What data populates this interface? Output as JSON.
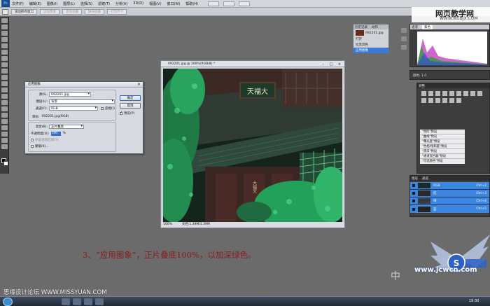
{
  "menubar": {
    "logo": "Ps",
    "items": [
      "文件(F)",
      "编辑(E)",
      "图像(I)",
      "图层(L)",
      "选择(S)",
      "滤镜(T)",
      "分析(A)",
      "3D(D)",
      "视图(V)",
      "窗口(W)",
      "帮助(H)"
    ]
  },
  "options_bar": {
    "buttons": [
      "滚动所有窗口",
      "实际像素",
      "适合屏幕",
      "填充屏幕",
      "打印尺寸"
    ]
  },
  "watermark_top": {
    "line1": "网页教学网",
    "line2": "WWW.WEBJX.COM"
  },
  "document": {
    "title": "092201.jpg @ 100%(RGB/8) *",
    "zoom": "100%",
    "doc_info": "文档:1.39M/1.39M",
    "sign_top": "天福大",
    "sign_side": "大福天"
  },
  "dialog": {
    "title": "应用图象",
    "source_label": "源(S):",
    "source_value": "092201.jpg",
    "layer_label": "图层(L):",
    "layer_value": "背景",
    "channel_label": "通道(C):",
    "channel_value": "RGB",
    "invert_label": "反相(I)",
    "target_label": "目标:",
    "target_value": "092201.jpg(RGB)",
    "blend_label": "混合(B):",
    "blend_value": "正片叠底",
    "opacity_label": "不透明度(O):",
    "opacity_value": "100",
    "opacity_unit": "%",
    "preserve_label": "保留透明区域(T)",
    "mask_label": "蒙版(K)...",
    "ok_label": "确定",
    "cancel_label": "取消",
    "preview_label": "预览(P)"
  },
  "history_panel": {
    "tabs": [
      "历史记录",
      "动作"
    ],
    "snapshot": "092201.jpg",
    "items": [
      "打开",
      "拉黑调色",
      "应用图像"
    ]
  },
  "channels_panel": {
    "tabs": [
      "通道",
      "路径"
    ],
    "value": "紫色"
  },
  "info_row": "颜色: 1 0",
  "adjust_panel": {
    "title": "调整"
  },
  "presets": [
    "\"色阶\"预设",
    "\"曲线\"预设",
    "\"曝光度\"预设",
    "\"色相/饱和度\"预设",
    "\"黑白\"预设",
    "\"通道混合器\"预设",
    "\"可选颜色\"预设"
  ],
  "layers_panel": {
    "tabs": [
      "图层",
      "通道"
    ],
    "items": [
      {
        "name": "RGB",
        "shortcut": "Ctrl+2"
      },
      {
        "name": "红",
        "shortcut": "Ctrl+3"
      },
      {
        "name": "绿",
        "shortcut": "Ctrl+4"
      },
      {
        "name": "蓝",
        "shortcut": "Ctrl+5"
      }
    ]
  },
  "caption": "3、“应用图象”，正片叠底100%，以加深绿色。",
  "watermark_bottom": "思缘设计论坛 WWW.MISSYUAN.COM",
  "watermark_logo": {
    "text1": "中",
    "text2": "www.jcwcn.com"
  },
  "taskbar": {
    "clock": "19:30"
  }
}
